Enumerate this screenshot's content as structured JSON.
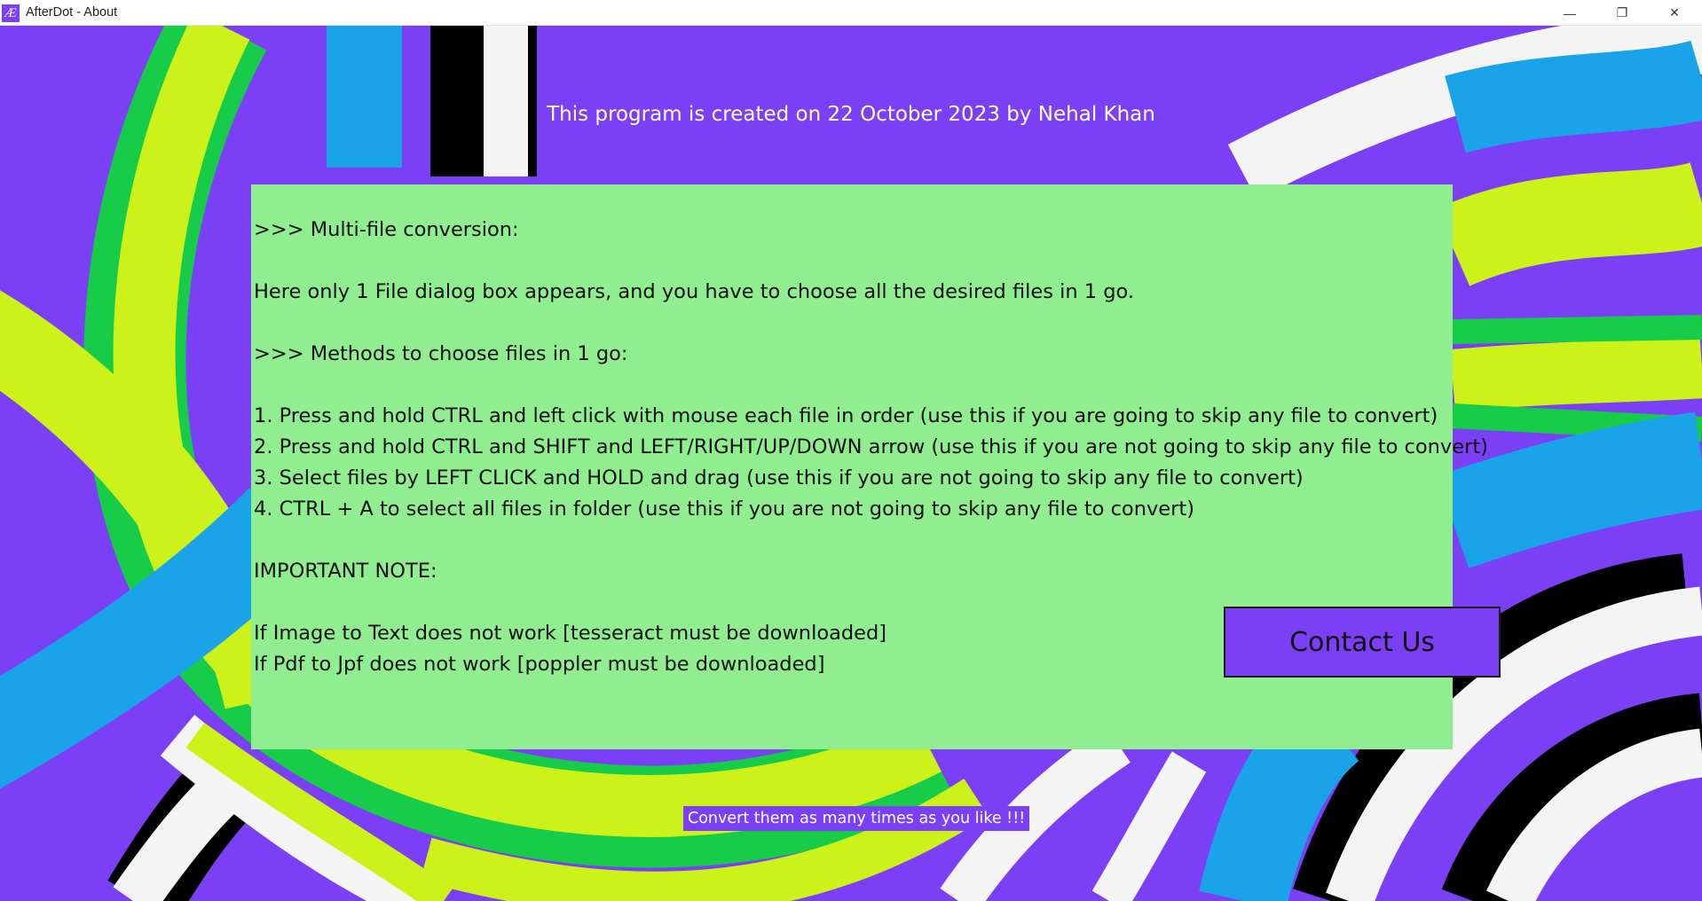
{
  "window": {
    "title": "AfterDot - About",
    "icon_glyph": "Æ",
    "controls": {
      "minimize": "—",
      "restore": "❐",
      "close": "✕"
    }
  },
  "header": {
    "creator_line": "This program is created on 22 October 2023 by Nehal Khan"
  },
  "info": {
    "lines": [
      ">>> Multi-file conversion:",
      "",
      "Here only 1 File dialog box appears, and you have to choose all the desired files in 1 go.",
      "",
      ">>> Methods to choose files in 1 go:",
      "",
      "1. Press and hold CTRL and left click with mouse each file in order (use this if you are going to skip any file to convert)",
      "2. Press and hold CTRL and SHIFT and LEFT/RIGHT/UP/DOWN arrow (use this if you are not going to skip any file to convert)",
      "3. Select files by LEFT CLICK and HOLD and drag (use this if you are not going to skip any file to convert)",
      "4. CTRL + A to select all files in folder (use this if you are not going to skip any file to convert)",
      "",
      "IMPORTANT NOTE:",
      "",
      "If Image to Text does not work [tesseract must be downloaded]",
      "If Pdf to Jpf does not work [poppler must be downloaded]"
    ]
  },
  "contact_button": {
    "label": "Contact Us"
  },
  "footer": {
    "tagline": "Convert them as many times as you like !!!"
  },
  "colors": {
    "background": "#7b3ff5",
    "panel": "#90ee90",
    "green": "#16cc48",
    "yellow": "#cdf21a",
    "blue": "#1aa3e8",
    "white": "#f4f4f4",
    "black": "#000000"
  }
}
